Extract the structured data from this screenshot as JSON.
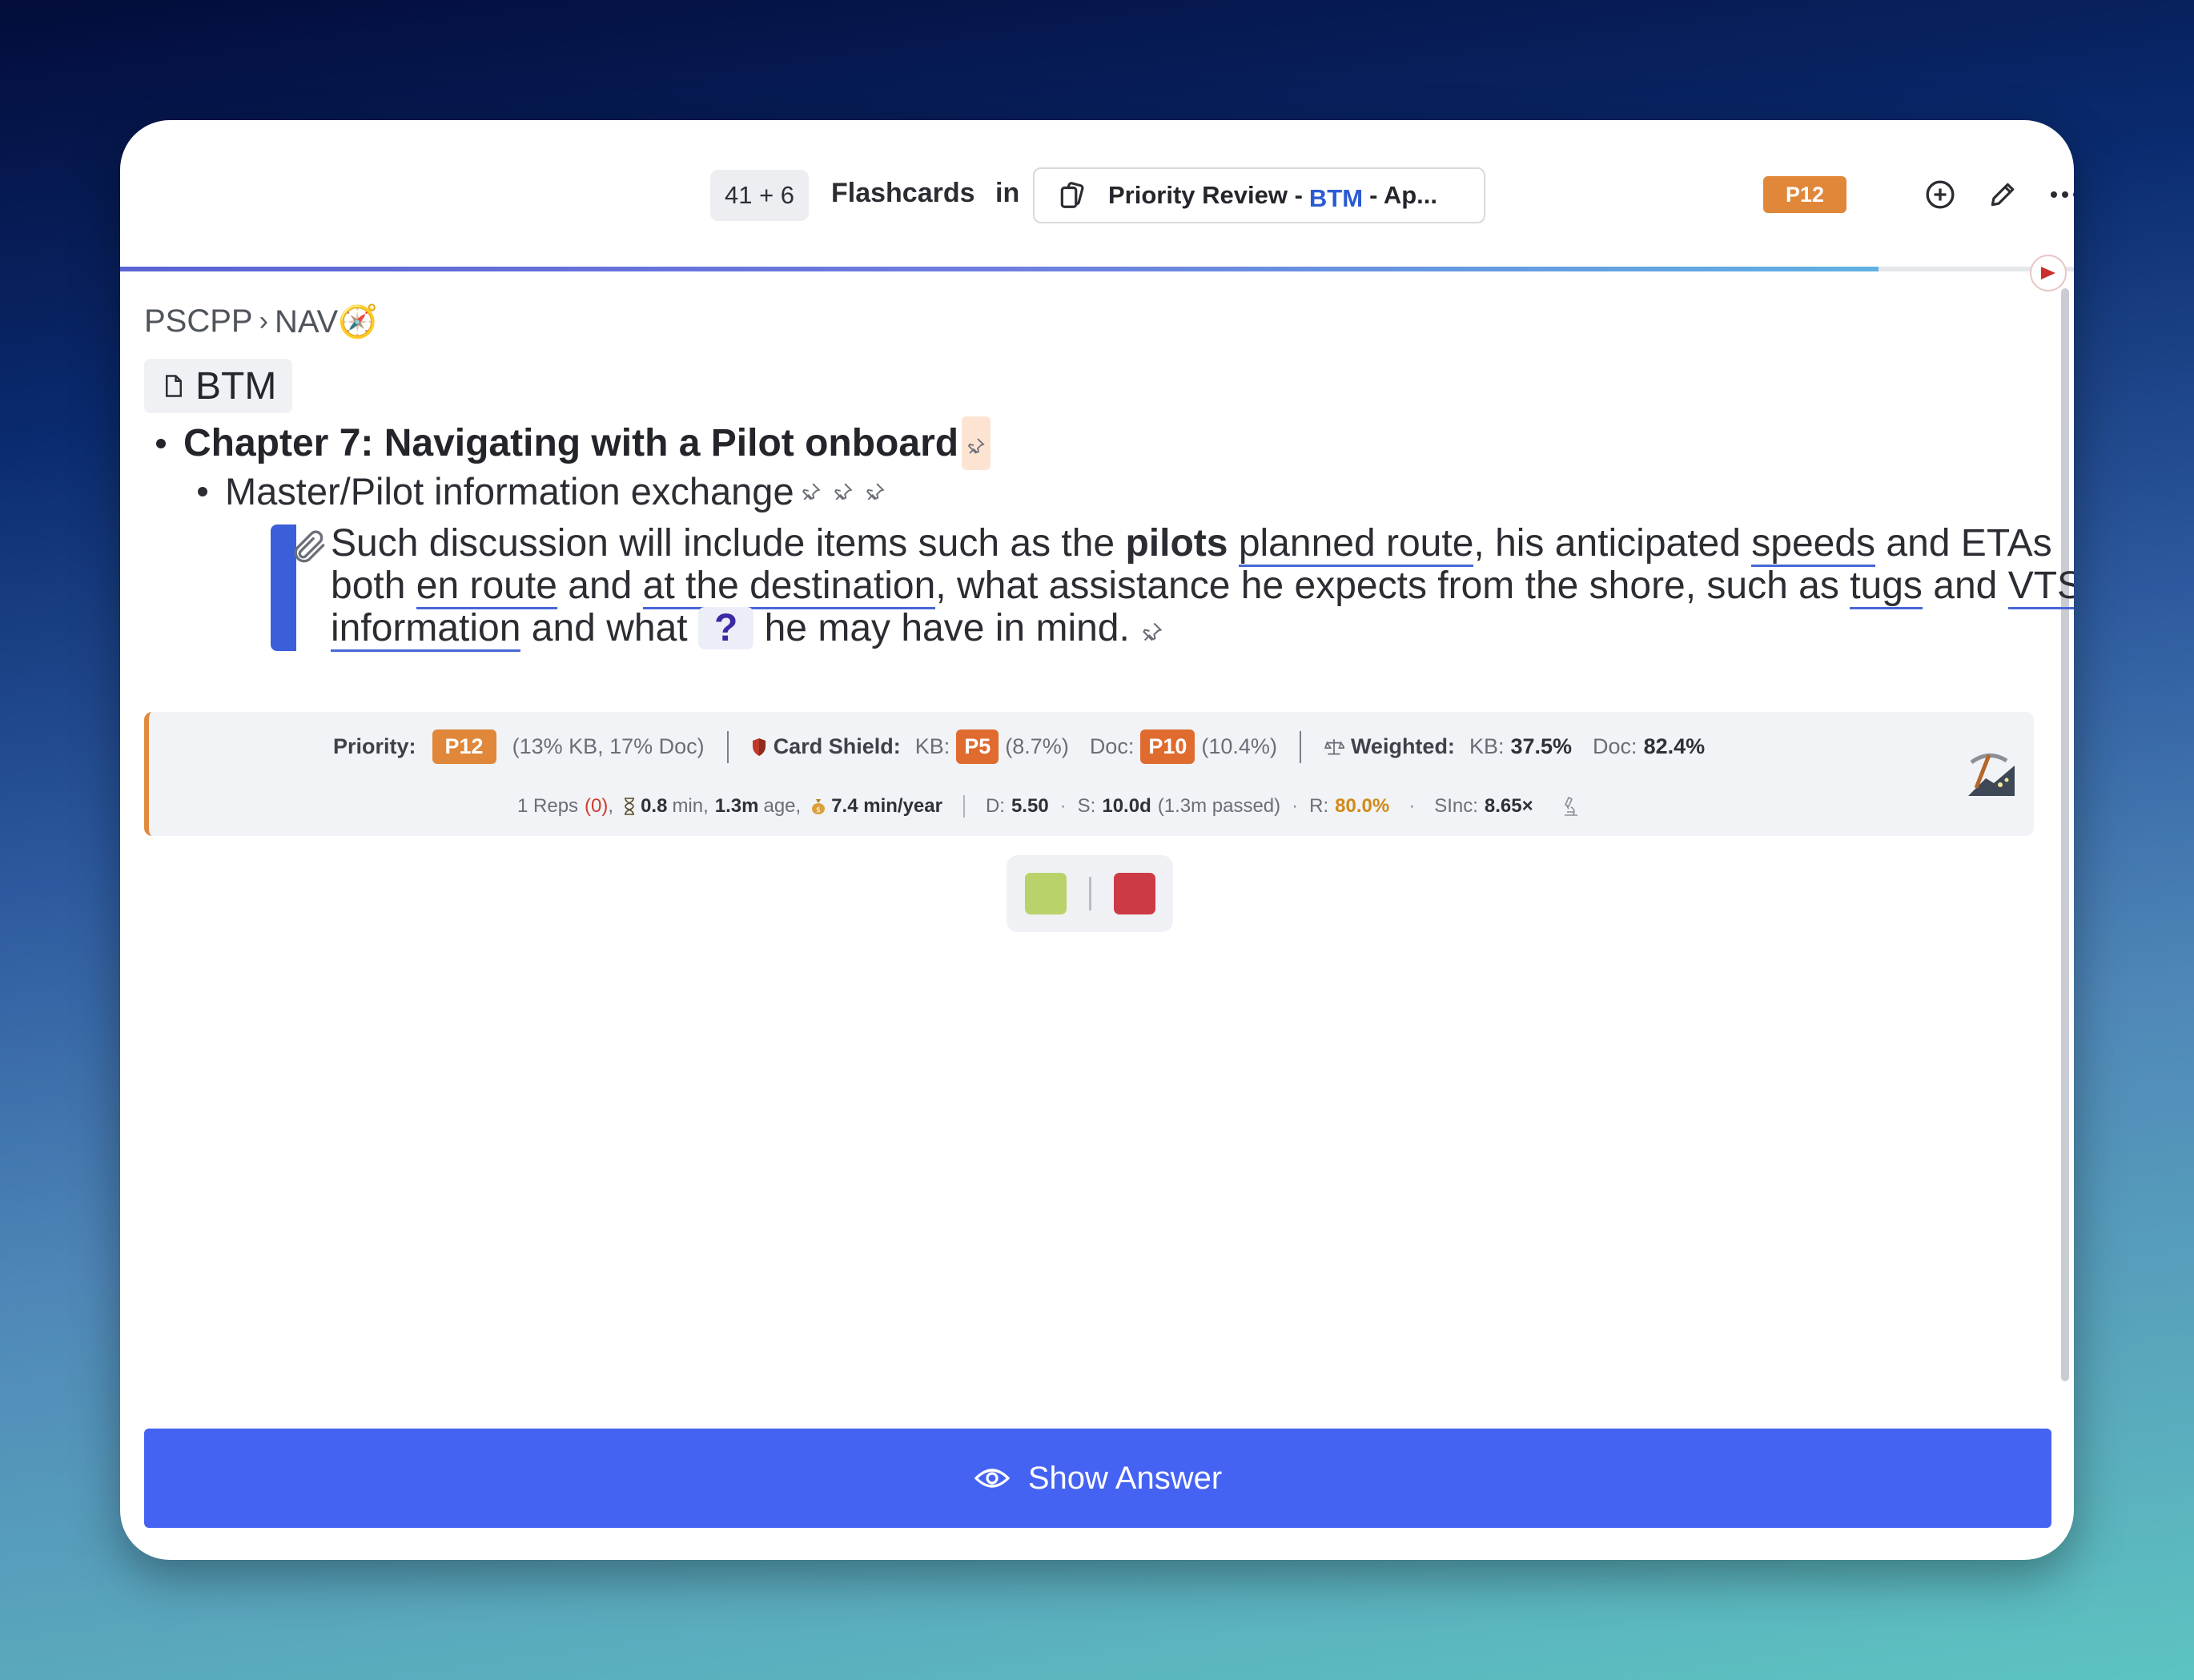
{
  "header": {
    "count": "41 + 6",
    "flashcards_label": "Flashcards",
    "in_label": "in",
    "deck_prefix": "Priority Review -",
    "deck_tag": "BTM",
    "deck_suffix": "- Ap...",
    "priority_badge": "P12",
    "icons": [
      "add-circle-icon",
      "pencil-icon",
      "more-icon"
    ]
  },
  "progress": {
    "fraction": 0.9
  },
  "breadcrumb": {
    "parent": "PSCPP",
    "separator": "›",
    "current": "NAV🧭"
  },
  "document": {
    "title": "BTM"
  },
  "outline": {
    "heading": "Chapter 7: Navigating with a Pilot onboard",
    "subheading": "Master/Pilot information exchange"
  },
  "card": {
    "t1": "Such discussion will include items such as the ",
    "t2": "pilots",
    "t3": " ",
    "u1": "planned route",
    "t4": ", his anticipated ",
    "u2": "speeds",
    "t5": " and ETAs both ",
    "u3": "en route",
    "t6": " and ",
    "u4": "at the destination",
    "t7": ", what assistance he expects from the shore, such as ",
    "u5": "tugs",
    "t8": " and ",
    "u6": "VTS information",
    "t9": " and what ",
    "cloze": "?",
    "t10": " he may have in mind."
  },
  "stats": {
    "priority_label": "Priority:",
    "priority_value": "P12",
    "priority_pct": "(13% KB, 17% Doc)",
    "shield_label": "Card Shield:",
    "kb_label": "KB:",
    "kb_badge": "P5",
    "kb_pct": "(8.7%)",
    "doc_label": "Doc:",
    "doc_badge": "P10",
    "doc_pct": "(10.4%)",
    "weighted_label": "Weighted:",
    "w_kb_label": "KB:",
    "w_kb_value": "37.5%",
    "w_doc_label": "Doc:",
    "w_doc_value": "82.4%",
    "reps": "1 Reps",
    "reps_fail": "(0)",
    "comma": ",",
    "time_value": "0.8",
    "time_unit": "min,",
    "age_value": "1.3m",
    "age_unit": "age,",
    "rate": "7.4 min/year",
    "d_label": "D:",
    "d_value": "5.50",
    "s_label": "S:",
    "s_value": "10.0d",
    "s_passed": "(1.3m passed)",
    "r_label": "R:",
    "r_value": "80.0%",
    "sinc_label": "SInc:",
    "sinc_value": "8.65×"
  },
  "grades": {
    "good_color": "#b9d26a",
    "again_color": "#cc3b45"
  },
  "actions": {
    "show_answer": "Show Answer"
  }
}
